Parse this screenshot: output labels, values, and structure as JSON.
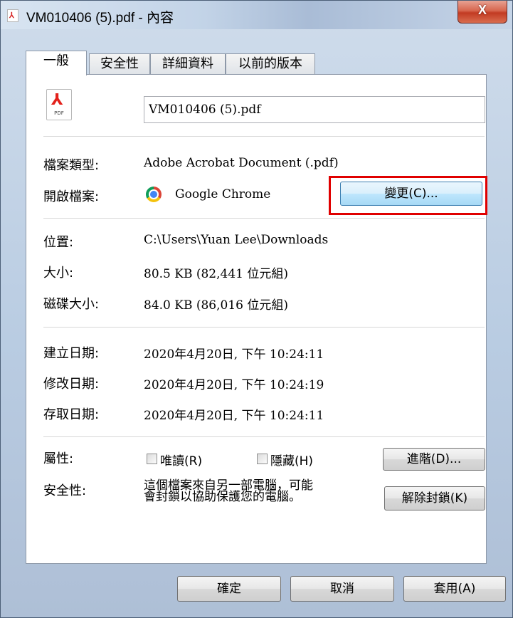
{
  "window": {
    "title": "VM010406 (5).pdf - 內容",
    "close": "X",
    "title_icon_glyph": "⅄"
  },
  "tabs": [
    {
      "label": "一般",
      "active": true
    },
    {
      "label": "安全性",
      "active": false
    },
    {
      "label": "詳細資料",
      "active": false
    },
    {
      "label": "以前的版本",
      "active": false
    }
  ],
  "file": {
    "icon_symbol": "⅄",
    "icon_label": "PDF",
    "name": "VM010406 (5).pdf"
  },
  "type_section": {
    "type_label": "檔案類型:",
    "type_value": "Adobe Acrobat Document (.pdf)",
    "open_label": "開啟檔案:",
    "open_value": "Google Chrome",
    "change_button": "變更(C)..."
  },
  "location_section": {
    "location_label": "位置:",
    "location_value": "C:\\Users\\Yuan Lee\\Downloads",
    "size_label": "大小:",
    "size_value": "80.5 KB (82,441 位元組)",
    "disk_label": "磁碟大小:",
    "disk_value": "84.0 KB (86,016 位元組)"
  },
  "dates_section": {
    "created_label": "建立日期:",
    "created_value": "2020年4月20日, 下午 10:24:11",
    "modified_label": "修改日期:",
    "modified_value": "2020年4月20日, 下午 10:24:19",
    "accessed_label": "存取日期:",
    "accessed_value": "2020年4月20日, 下午 10:24:11"
  },
  "attributes": {
    "label": "屬性:",
    "readonly": "唯讀(R)",
    "hidden": "隱藏(H)",
    "advanced_button": "進階(D)...",
    "security_label": "安全性:",
    "security_line1": "這個檔案來自另一部電腦，可能",
    "security_line2": "會封鎖以協助保護您的電腦。",
    "unblock_button": "解除封鎖(K)"
  },
  "footer": {
    "ok": "確定",
    "cancel": "取消",
    "apply": "套用(A)"
  },
  "colors": {
    "highlight": "#e00000",
    "close": "#c23b22"
  }
}
